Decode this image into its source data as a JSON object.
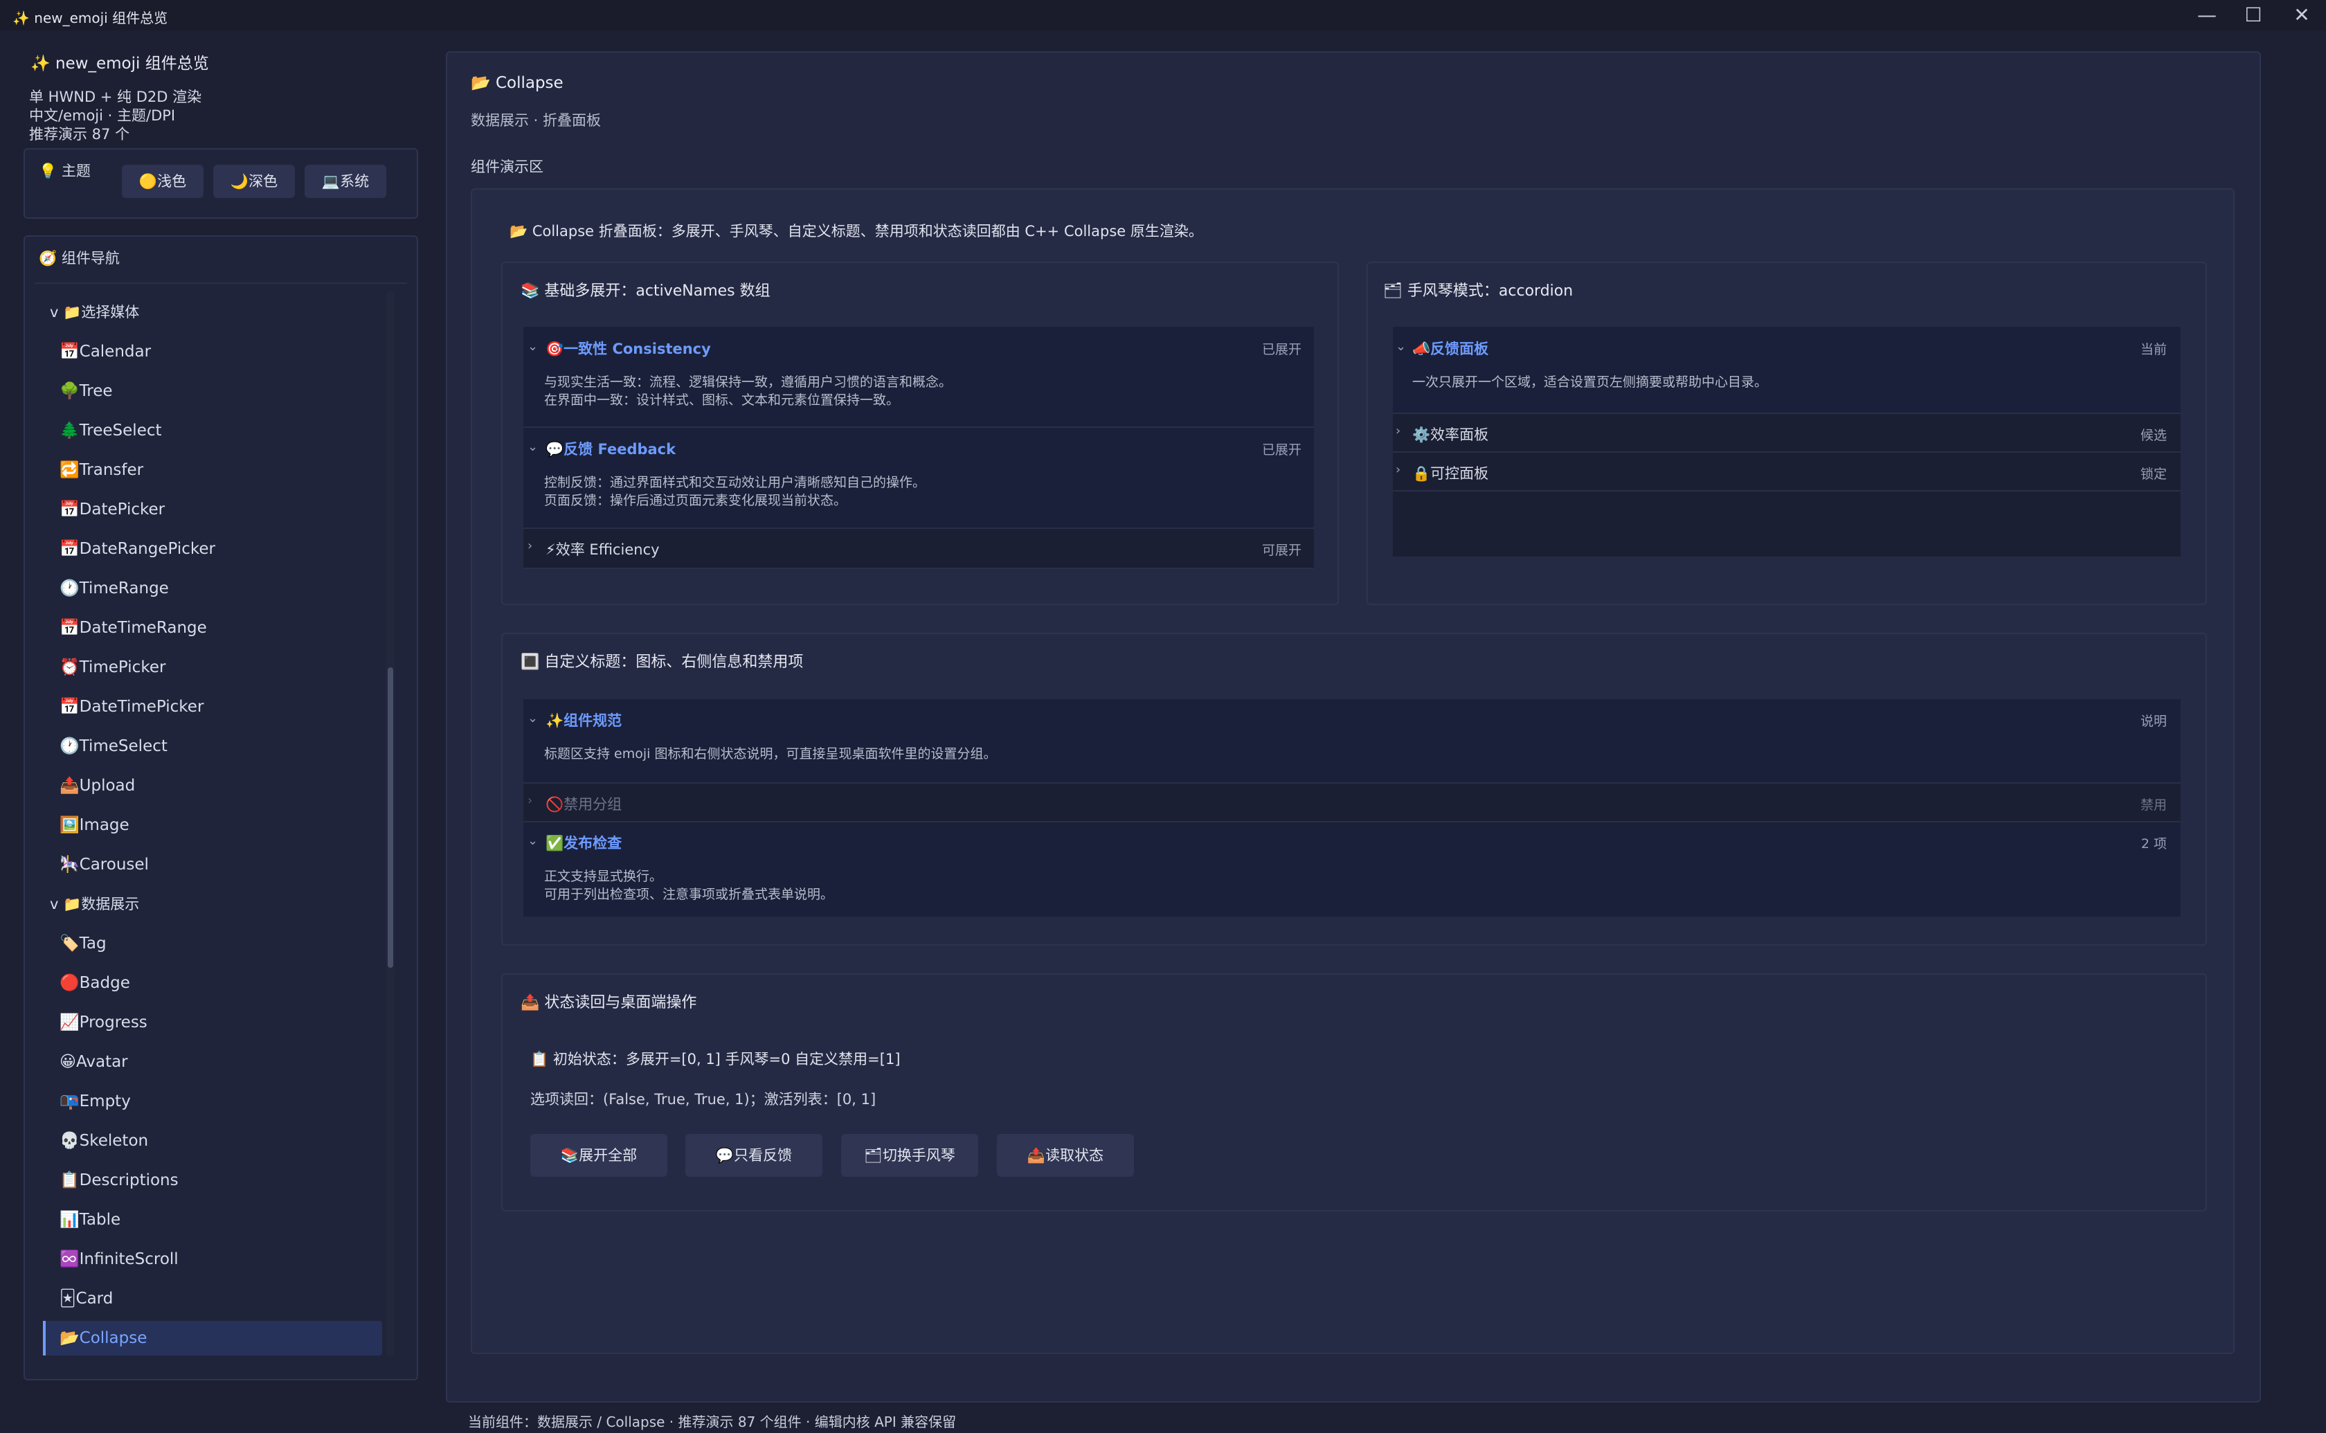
{
  "window": {
    "title": "new_emoji 组件总览",
    "icon": "✨"
  },
  "sidebar": {
    "app_title": "new_emoji 组件总览",
    "info_line1": "单 HWND + 纯 D2D 渲染",
    "info_line2": "中文/emoji · 主题/DPI",
    "info_line3": "推荐演示 87 个",
    "theme": {
      "label": "主题",
      "buttons": [
        "🟡浅色",
        "🌙深色",
        "💻系统"
      ]
    },
    "nav": {
      "label": "组件导航",
      "groups": [
        {
          "label": "v 📁选择媒体"
        },
        {
          "label": "v 📁数据展示"
        }
      ],
      "items": [
        "📅Calendar",
        "🌳Tree",
        "🌲TreeSelect",
        "🔁Transfer",
        "📅DatePicker",
        "📅DateRangePicker",
        "🕐TimeRange",
        "📅DateTimeRange",
        "⏰TimePicker",
        "📅DateTimePicker",
        "🕐TimeSelect",
        "📤Upload",
        "🖼️Image",
        "🎠Carousel",
        "🏷️Tag",
        "🔴Badge",
        "📈Progress",
        "😀Avatar",
        "📭Empty",
        "💀Skeleton",
        "📋Descriptions",
        "📊Table",
        "♾️InfiniteScroll",
        "🃏Card",
        "📂Collapse"
      ]
    }
  },
  "main": {
    "title": "📂 Collapse",
    "subtitle": "数据展示 · 折叠面板",
    "section_label": "组件演示区",
    "intro": "📂 Collapse 折叠面板：多展开、手风琴、自定义标题、禁用项和状态读回都由 C++ Collapse 原生渲染。",
    "basic": {
      "title": "📚 基础多展开：activeNames 数组",
      "items": [
        {
          "title": "🎯一致性 Consistency",
          "status": "已展开",
          "body1": "与现实生活一致：流程、逻辑保持一致，遵循用户习惯的语言和概念。",
          "body2": "在界面中一致：设计样式、图标、文本和元素位置保持一致。"
        },
        {
          "title": "💬反馈 Feedback",
          "status": "已展开",
          "body1": "控制反馈：通过界面样式和交互动效让用户清晰感知自己的操作。",
          "body2": "页面反馈：操作后通过页面元素变化展现当前状态。"
        },
        {
          "title": "⚡效率 Efficiency",
          "status": "可展开"
        }
      ]
    },
    "accordion": {
      "title": "🗂 手风琴模式：accordion",
      "items": [
        {
          "title": "📣反馈面板",
          "status": "当前",
          "body": "一次只展开一个区域，适合设置页左侧摘要或帮助中心目录。"
        },
        {
          "title": "⚙️效率面板",
          "status": "候选"
        },
        {
          "title": "🔒可控面板",
          "status": "锁定"
        }
      ]
    },
    "custom": {
      "title": "🔳 自定义标题：图标、右侧信息和禁用项",
      "items": [
        {
          "title": "✨组件规范",
          "status": "说明",
          "body": "标题区支持 emoji 图标和右侧状态说明，可直接呈现桌面软件里的设置分组。"
        },
        {
          "title": "🚫禁用分组",
          "status": "禁用"
        },
        {
          "title": "✅发布检查",
          "status": "2 项",
          "body1": "正文支持显式换行。",
          "body2": "可用于列出检查项、注意事项或折叠式表单说明。"
        }
      ]
    },
    "state": {
      "title": "📤 状态读回与桌面端操作",
      "initial": "📋 初始状态：多展开=[0, 1] 手风琴=0 自定义禁用=[1]",
      "readback": "选项读回：(False, True, True, 1)；激活列表：[0, 1]",
      "buttons": [
        "📚展开全部",
        "💬只看反馈",
        "🗂切换手风琴",
        "📤读取状态"
      ]
    }
  },
  "status_bar": "当前组件：数据展示 / Collapse · 推荐演示 87 个组件 · 编辑内核 API 兼容保留",
  "colors": {
    "accent": "#6d9bff",
    "background": "#1d2033",
    "panel": "#232840",
    "selected": "#263259"
  }
}
